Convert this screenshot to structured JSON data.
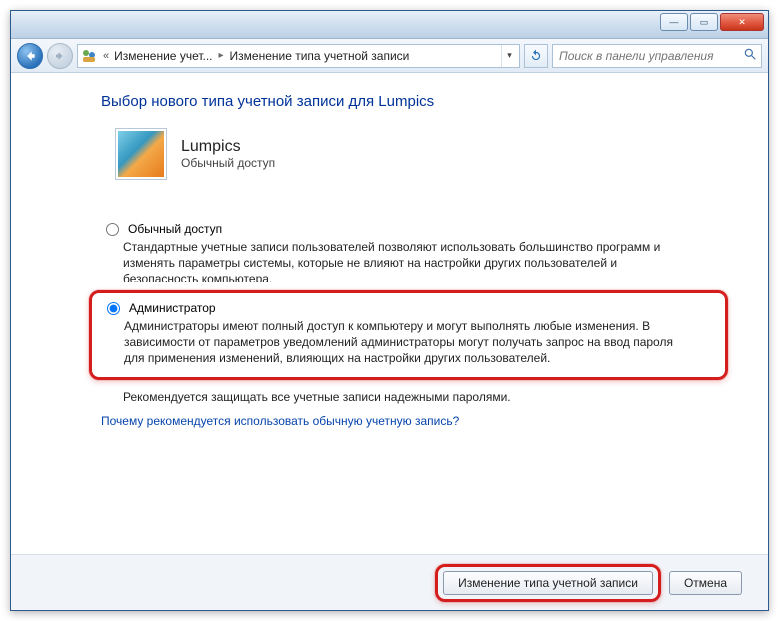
{
  "titlebar": {
    "minimize": "—",
    "maximize": "▭",
    "close": "✕"
  },
  "nav": {
    "breadcrumb_prefix": "«",
    "breadcrumb1": "Изменение учет...",
    "breadcrumb2": "Изменение типа учетной записи",
    "search_placeholder": "Поиск в панели управления"
  },
  "page": {
    "title": "Выбор нового типа учетной записи для Lumpics",
    "user_name": "Lumpics",
    "user_role": "Обычный доступ",
    "opt_standard_label": "Обычный доступ",
    "opt_standard_desc": "Стандартные учетные записи пользователей позволяют использовать большинство программ и изменять параметры системы, которые не влияют на настройки других пользователей и безопасность компьютера.",
    "opt_admin_label": "Администратор",
    "opt_admin_desc": "Администраторы имеют полный доступ к компьютеру и могут выполнять любые изменения. В зависимости от параметров уведомлений администраторы могут получать запрос на ввод пароля для применения изменений, влияющих на настройки других пользователей.",
    "recommend": "Рекомендуется защищать все учетные записи надежными паролями.",
    "why_link": "Почему рекомендуется использовать обычную учетную запись?"
  },
  "footer": {
    "change_btn": "Изменение типа учетной записи",
    "cancel_btn": "Отмена"
  }
}
